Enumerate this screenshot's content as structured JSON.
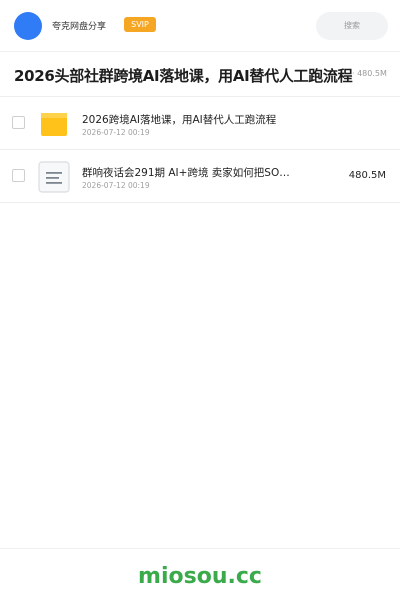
{
  "header": {
    "username": "夸克网盘分享",
    "badge": "SVIP",
    "search_placeholder": "搜索"
  },
  "folder": {
    "title": "2026头部社群跨境AI落地课，用AI替代人工跑流程",
    "size": "· 480.5M"
  },
  "files": [
    {
      "name": "2026跨境AI落地课，用AI替代人工跑流程",
      "date": "2026-07-12 00:19",
      "size": "",
      "icon": "folder-icon"
    },
    {
      "name": "群响夜话会291期  AI+跨境  卖家如何把SO…",
      "date": "2026-07-12 00:19",
      "size": "480.5M",
      "icon": "document-icon"
    }
  ],
  "footer": {
    "brand": "miosou.cc"
  },
  "colors": {
    "avatar": "#2f7cf6",
    "svip_badge": "#f5a623",
    "brand": "#3aaa4a",
    "folder": "#ffc21a"
  }
}
